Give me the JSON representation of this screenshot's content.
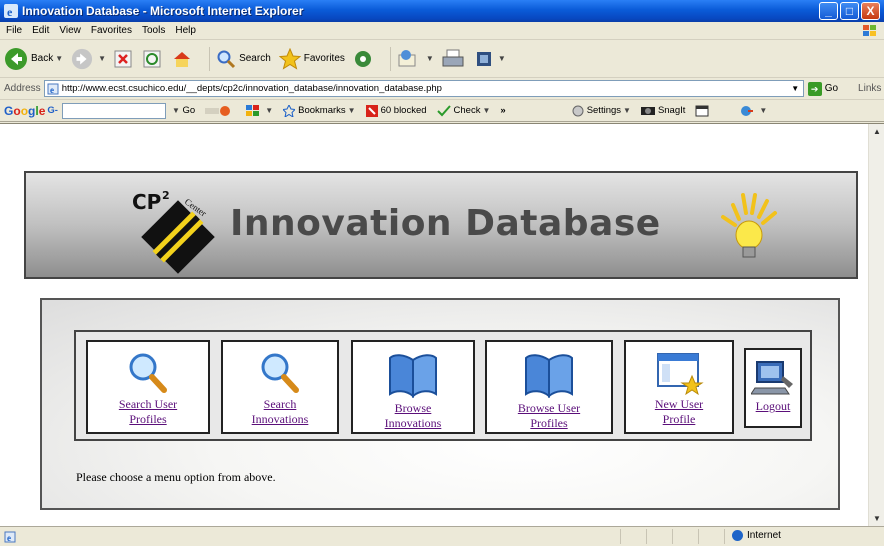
{
  "window": {
    "title": "Innovation Database - Microsoft Internet Explorer",
    "buttons": {
      "minimize": "_",
      "maximize": "□",
      "close": "X"
    }
  },
  "menubar": [
    "File",
    "Edit",
    "View",
    "Favorites",
    "Tools",
    "Help"
  ],
  "toolbar": {
    "back": "Back",
    "search": "Search",
    "favorites": "Favorites"
  },
  "address": {
    "label": "Address",
    "url": "http://www.ecst.csuchico.edu/__depts/cp2c/innovation_database/innovation_database.php",
    "go": "Go",
    "links": "Links"
  },
  "googlebar": {
    "logo": "Google",
    "g_label": "G-",
    "go": "Go",
    "bookmarks": "Bookmarks",
    "blocked": "60 blocked",
    "check": "Check",
    "more": "»",
    "settings": "Settings",
    "snagit": "SnagIt"
  },
  "banner": {
    "title": "Innovation Database",
    "logo_text": "CP",
    "logo_sup": "2",
    "logo_side": "Center"
  },
  "menu": {
    "options": [
      {
        "label_lines": [
          "Search User",
          "Profiles"
        ],
        "icon": "magnifier-icon"
      },
      {
        "label_lines": [
          "Search",
          "Innovations"
        ],
        "icon": "magnifier-icon"
      },
      {
        "label_lines": [
          "Browse",
          "Innovations"
        ],
        "icon": "open-book-icon"
      },
      {
        "label_lines": [
          "Browse User",
          "Profiles"
        ],
        "icon": "open-book-icon"
      },
      {
        "label_lines": [
          "New User",
          "Profile"
        ],
        "icon": "new-window-icon"
      },
      {
        "label_lines": [
          "Logout"
        ],
        "icon": "computer-icon"
      }
    ],
    "prompt": "Please choose a menu option from above."
  },
  "status": {
    "zone": "Internet"
  },
  "colors": {
    "title_bar": "#0a5bd8",
    "link": "#5b0f7a",
    "banner_text": "#4a4a4a"
  }
}
